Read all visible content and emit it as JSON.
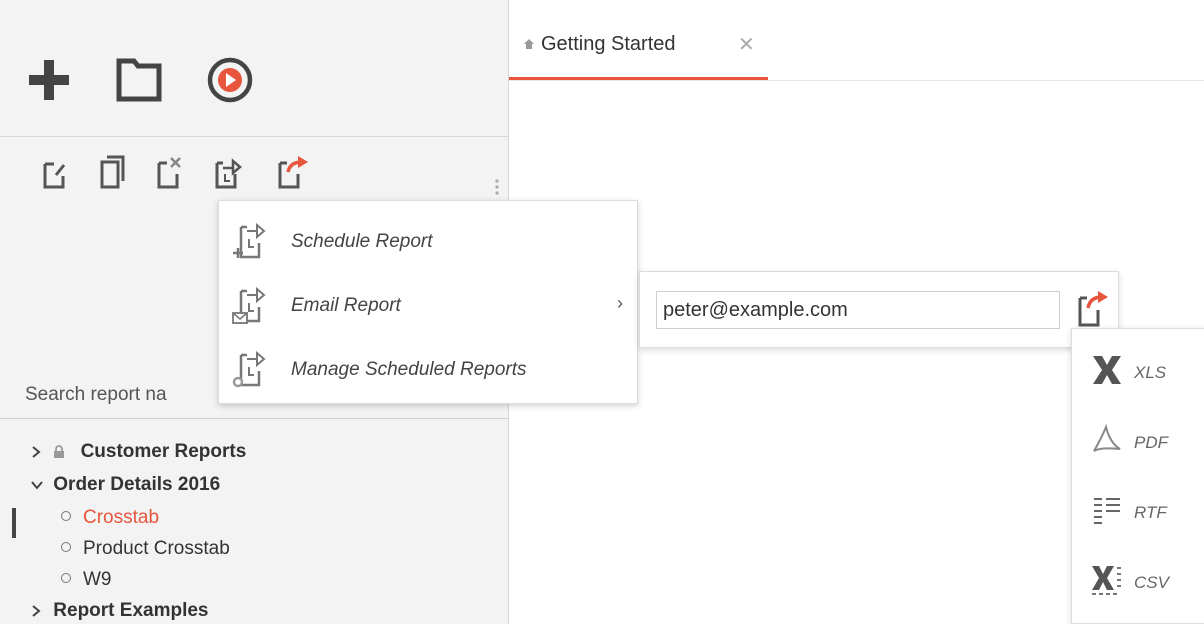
{
  "tab": {
    "label": "Getting Started",
    "close": "✕"
  },
  "top_actions": [
    "add-icon",
    "folder-icon",
    "play-icon"
  ],
  "toolbar": [
    "edit-report-icon",
    "copy-report-icon",
    "delete-report-icon",
    "schedule-report-icon",
    "share-report-icon"
  ],
  "menu": {
    "items": [
      {
        "label": "Schedule Report",
        "icon": "schedule-add-icon"
      },
      {
        "label": "Email Report",
        "icon": "schedule-email-icon",
        "has_submenu": true,
        "arrow": "›"
      },
      {
        "label": "Manage Scheduled Reports",
        "icon": "schedule-manage-icon"
      }
    ]
  },
  "email": {
    "value": "peter@example.com"
  },
  "formats": [
    {
      "label": "XLS",
      "icon": "excel-icon"
    },
    {
      "label": "PDF",
      "icon": "pdf-icon"
    },
    {
      "label": "RTF",
      "icon": "rtf-icon"
    },
    {
      "label": "CSV",
      "icon": "csv-icon"
    }
  ],
  "search": {
    "placeholder": "Search report na"
  },
  "tree": {
    "customer_reports": "Customer Reports",
    "order_details": "Order Details 2016",
    "crosstab": "Crosstab",
    "product_crosstab": "Product Crosstab",
    "w9": "W9",
    "report_examples": "Report Examples"
  },
  "colors": {
    "accent": "#e8553d",
    "icon_gray": "#555555"
  }
}
